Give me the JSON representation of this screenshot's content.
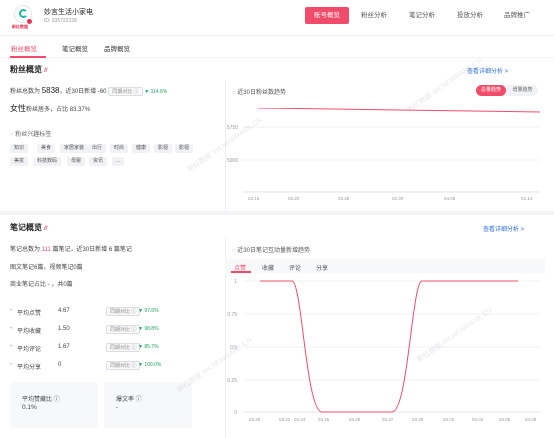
{
  "account": {
    "name": "妙言生活小家电",
    "id": "ID: 335722228",
    "logo_tag": "新红数据"
  },
  "top_nav": {
    "items": [
      "账号概览",
      "粉丝分析",
      "笔记分析",
      "投放分析",
      "品牌推广"
    ]
  },
  "sub_tabs": [
    "粉丝概览",
    "笔记概览",
    "品牌概览"
  ],
  "fans": {
    "title": "粉丝概览",
    "more": "查看详细分析 >",
    "total_prefix": "粉丝总数为",
    "total": "5838",
    "recent_prefix": "，近30日新增",
    "recent": "-60",
    "compare_label": "同期对比 ⓘ",
    "compare_value": "▼ 114.6%",
    "gender_label": "女性",
    "gender_desc": "粉丝居多，占比",
    "gender_pct": "83.37%",
    "interest_title": "粉丝兴趣标签",
    "tags": [
      "知识",
      "美食",
      "家居家装",
      "出行",
      "时尚",
      "健康",
      "影视",
      "影视",
      "美妆",
      "科技数码",
      "母婴",
      "资讯",
      "..."
    ]
  },
  "fans_chart": {
    "title": "近30日粉丝数趋势",
    "btn_active": "总量趋势",
    "btn_inactive": "增量趋势",
    "y_ticks": [
      "5750",
      "5000"
    ],
    "x_ticks": [
      "03.15",
      "03.20",
      "03.25",
      "03.30",
      "04.05",
      "04.14"
    ]
  },
  "notes": {
    "title": "笔记概览",
    "more": "查看详细分析 >",
    "line1_a": "笔记总数为",
    "line1_b": "111",
    "line1_c": "篇笔记，近30日新增",
    "line1_d": "6",
    "line1_e": "篇笔记",
    "line2": "图文笔记6篇，视频笔记0篇",
    "line3": "商业笔记占比 - ，共0篇",
    "metrics": [
      {
        "label": "平均点赞",
        "value": "4.67",
        "cmp": "同期对比 ⓘ",
        "change": "▼ 97.6%"
      },
      {
        "label": "平均收藏",
        "value": "1.50",
        "cmp": "同期对比 ⓘ",
        "change": "▼ 98.8%"
      },
      {
        "label": "平均评论",
        "value": "1.67",
        "cmp": "同期对比 ⓘ",
        "change": "▼ 85.7%"
      },
      {
        "label": "平均分享",
        "value": "0",
        "cmp": "同期对比 ⓘ",
        "change": "▼ 100.0%"
      }
    ],
    "box1_label": "平均赞藏比 ⓘ",
    "box1_value": "0.1%",
    "box2_label": "爆文率 ⓘ",
    "box2_value": "-"
  },
  "notes_chart": {
    "title": "近30日笔记互动量新增趋势",
    "tabs": [
      "点赞",
      "收藏",
      "评论",
      "分享"
    ],
    "y_ticks": [
      "1",
      "0.75",
      "0.5",
      "0.25",
      "0"
    ],
    "x_ticks": [
      "03.20",
      "03.22",
      "03.24",
      "03.25",
      "03.26",
      "03.27",
      "03.28",
      "04.02",
      "04.03",
      "04.05",
      "04.09"
    ]
  },
  "watermark": "新红数据 XH.NEWRANK.CN",
  "colors": {
    "accent": "#f04b6a",
    "link": "#2f6fd8",
    "up": "#1aa55f"
  }
}
